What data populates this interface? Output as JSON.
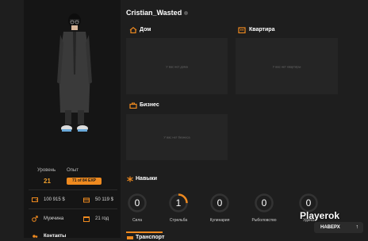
{
  "player": {
    "name": "Cristian_Wasted"
  },
  "profile": {
    "level_label": "Уровень",
    "level_value": "21",
    "exp_label": "Опыт",
    "exp_value": "71 of 84 EXP",
    "cash": "100 915 $",
    "bank": "50 119 $",
    "gender": "Мужчина",
    "age": "21 год",
    "bottom_section": "Контакты"
  },
  "sections": {
    "house": {
      "title": "Дом",
      "empty": "У вас нет дома"
    },
    "apartment": {
      "title": "Квартира",
      "empty": "У вас нет квартиры"
    },
    "business": {
      "title": "Бизнес",
      "empty": "У вас нет бизнеса"
    },
    "skills": {
      "title": "Навыки"
    },
    "transport": {
      "title": "Транспорт"
    }
  },
  "skills": [
    {
      "label": "Сила",
      "value": "0",
      "progress": 0
    },
    {
      "label": "Стрельба",
      "value": "1",
      "progress": 0.25
    },
    {
      "label": "Кулинария",
      "value": "0",
      "progress": 0
    },
    {
      "label": "Рыболовство",
      "value": "0",
      "progress": 0
    },
    {
      "label": "Удача",
      "value": "0",
      "progress": 0
    }
  ],
  "watermark": "Playerok",
  "scroll_top": {
    "label": "НАВЕРХ",
    "icon": "arrow-up-icon"
  },
  "colors": {
    "accent": "#ef8a1f",
    "panel": "#151515",
    "card": "#252525",
    "background": "#1e1e1e"
  }
}
